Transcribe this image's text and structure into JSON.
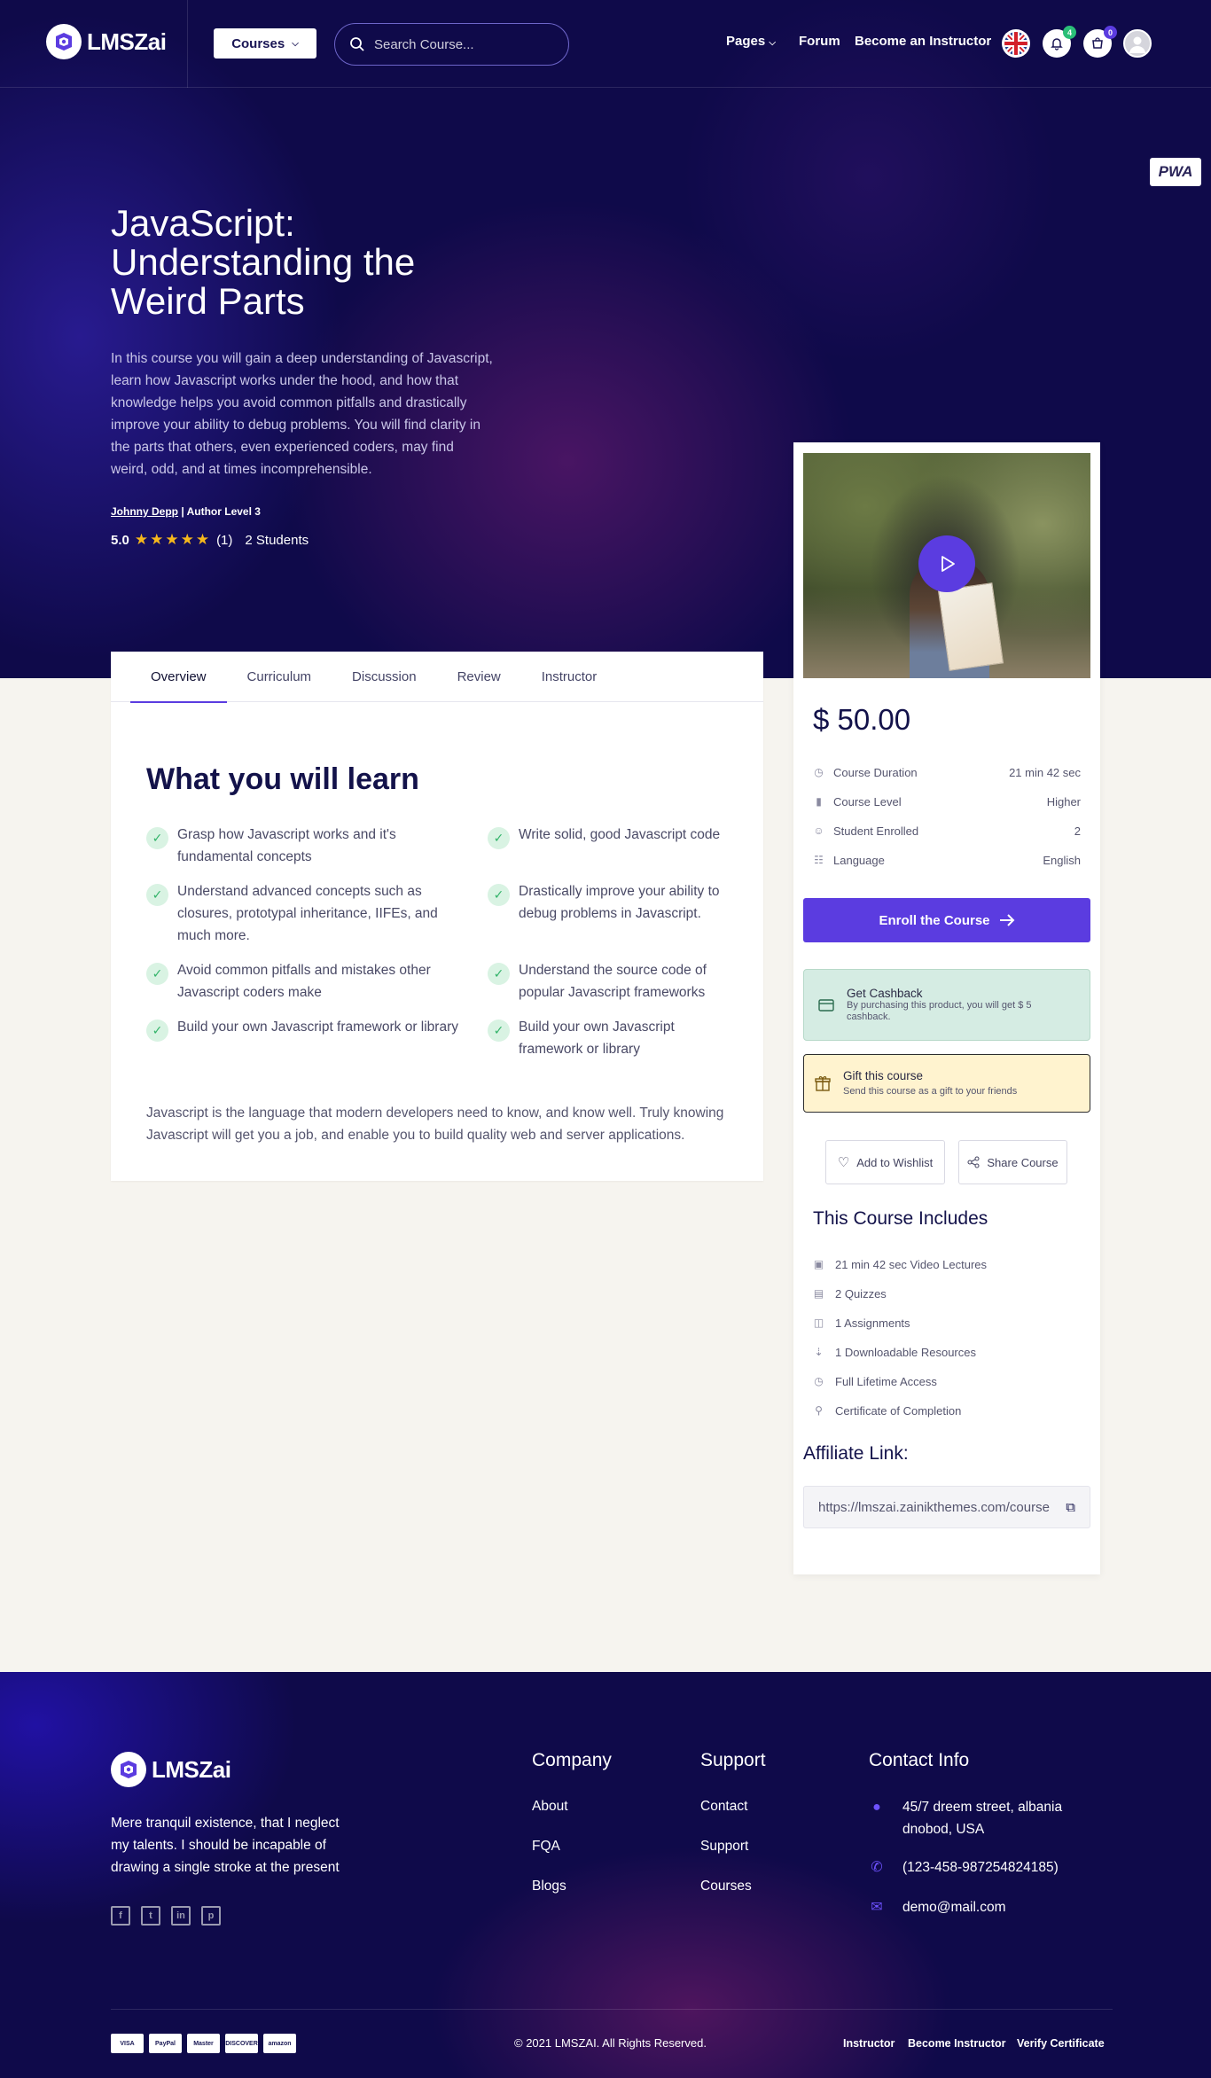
{
  "header": {
    "logo_text": "LMSZai",
    "courses_label": "Courses",
    "search_placeholder": "Search Course...",
    "nav": [
      "Pages",
      "Forum",
      "Become an Instructor"
    ],
    "notification_count": "4",
    "cart_count": "0"
  },
  "pwa_label": "PWA",
  "course": {
    "title": "JavaScript: Understanding the Weird Parts",
    "description": "In this course you will gain a deep understanding of Javascript, learn how Javascript works under the hood, and how that knowledge helps you avoid common pitfalls and drastically improve your ability to debug problems. You will find clarity in the parts that others, even experienced coders, may find weird, odd, and at times incomprehensible.",
    "author_name": "Johnny Depp",
    "author_level": " | Author Level 3",
    "rating_value": "5.0",
    "rating_count": "(1)",
    "students": "2 Students"
  },
  "tabs": [
    "Overview",
    "Curriculum",
    "Discussion",
    "Review",
    "Instructor"
  ],
  "learn": {
    "title": "What you will learn",
    "items": [
      "Grasp how Javascript works and it's fundamental concepts",
      "Write solid, good Javascript code",
      "Understand advanced concepts such as closures, prototypal inheritance, IIFEs, and much more.",
      "Drastically improve your ability to debug problems in Javascript.",
      "Avoid common pitfalls and mistakes other Javascript coders make",
      "Understand the source code of popular Javascript frameworks",
      "Build your own Javascript framework or library",
      "Build your own Javascript framework or library"
    ],
    "paragraph": "Javascript is the language that modern developers need to know, and know well. Truly knowing Javascript will get you a job, and enable you to build quality web and server applications."
  },
  "sidebar": {
    "price": "$ 50.00",
    "meta": [
      {
        "icon": "clock-icon",
        "label": "Course Duration",
        "value": "21 min 42 sec"
      },
      {
        "icon": "bar-chart-icon",
        "label": "Course Level",
        "value": "Higher"
      },
      {
        "icon": "users-icon",
        "label": "Student Enrolled",
        "value": "2"
      },
      {
        "icon": "language-icon",
        "label": "Language",
        "value": "English"
      }
    ],
    "enroll_label": "Enroll the Course",
    "cashback_title": "Get Cashback",
    "cashback_text": "By purchasing this product, you will get $ 5 cashback.",
    "gift_title": "Gift this course",
    "gift_text": "Send this course as a gift to your friends",
    "wishlist_label": "Add to Wishlist",
    "share_label": "Share Course",
    "includes_title": "This Course Includes",
    "includes": [
      "21 min 42 sec Video Lectures",
      "2 Quizzes",
      "1 Assignments",
      "1 Downloadable Resources",
      "Full Lifetime Access",
      "Certificate of Completion"
    ],
    "affiliate_title": "Affiliate Link:",
    "affiliate_value": "https://lmszai.zainikthemes.com/course"
  },
  "footer": {
    "logo_text": "LMSZai",
    "description": "Mere tranquil existence, that I neglect my talents. I should be incapable of drawing a single stroke at the present",
    "company_title": "Company",
    "company_links": [
      "About",
      "FQA",
      "Blogs"
    ],
    "support_title": "Support",
    "support_links": [
      "Contact",
      "Support",
      "Courses"
    ],
    "contact_title": "Contact Info",
    "address": "45/7 dreem street, albania dnobod, USA",
    "phone": "(123-458-987254824185)",
    "email": "demo@mail.com",
    "payment_cards": [
      "VISA",
      "PayPal",
      "Master",
      "DISCOVER",
      "amazon"
    ],
    "copyright": "© 2021 LMSZAI. All Rights Reserved.",
    "bottom_links": [
      "Instructor",
      "Become Instructor",
      "Verify Certificate"
    ]
  },
  "colors": {
    "primary": "#5b3ce0",
    "dark": "#0f0a4a",
    "star": "#f6b81c"
  }
}
